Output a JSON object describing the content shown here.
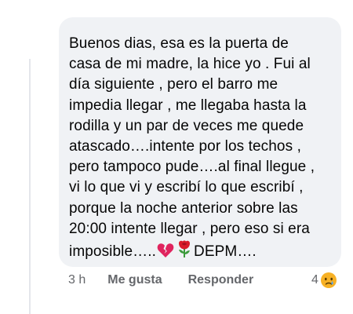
{
  "comment": {
    "lines": [
      "Buenos dias, esa es la puerta de",
      "casa de mi madre, la hice yo . Fui al",
      "día siguiente , pero el barro me",
      "impedia llegar , me llegaba hasta la",
      "rodilla y un par de veces me quede",
      "atascado….intente por los techos ,",
      "pero tampoco pude….al final llegue ,",
      "vi lo que vi y escribí lo que escribí ,",
      "porque la noche anterior sobre las",
      "20:00 intente llegar , pero eso si era"
    ],
    "last_line_start": "imposible…..",
    "last_line_end": "DEPM….",
    "emojis": [
      "broken-heart-icon",
      "rose-icon"
    ]
  },
  "actions": {
    "time": "3 h",
    "like": "Me gusta",
    "reply": "Responder"
  },
  "reactions": {
    "count": "4",
    "icon": "sad-crying-face-icon"
  },
  "colors": {
    "bubble": "#f0f2f5",
    "text": "#050505",
    "meta": "#65676b",
    "broken_heart": "#e0245e",
    "rose": "#d91a2a",
    "sad_face": "#f7b125"
  }
}
